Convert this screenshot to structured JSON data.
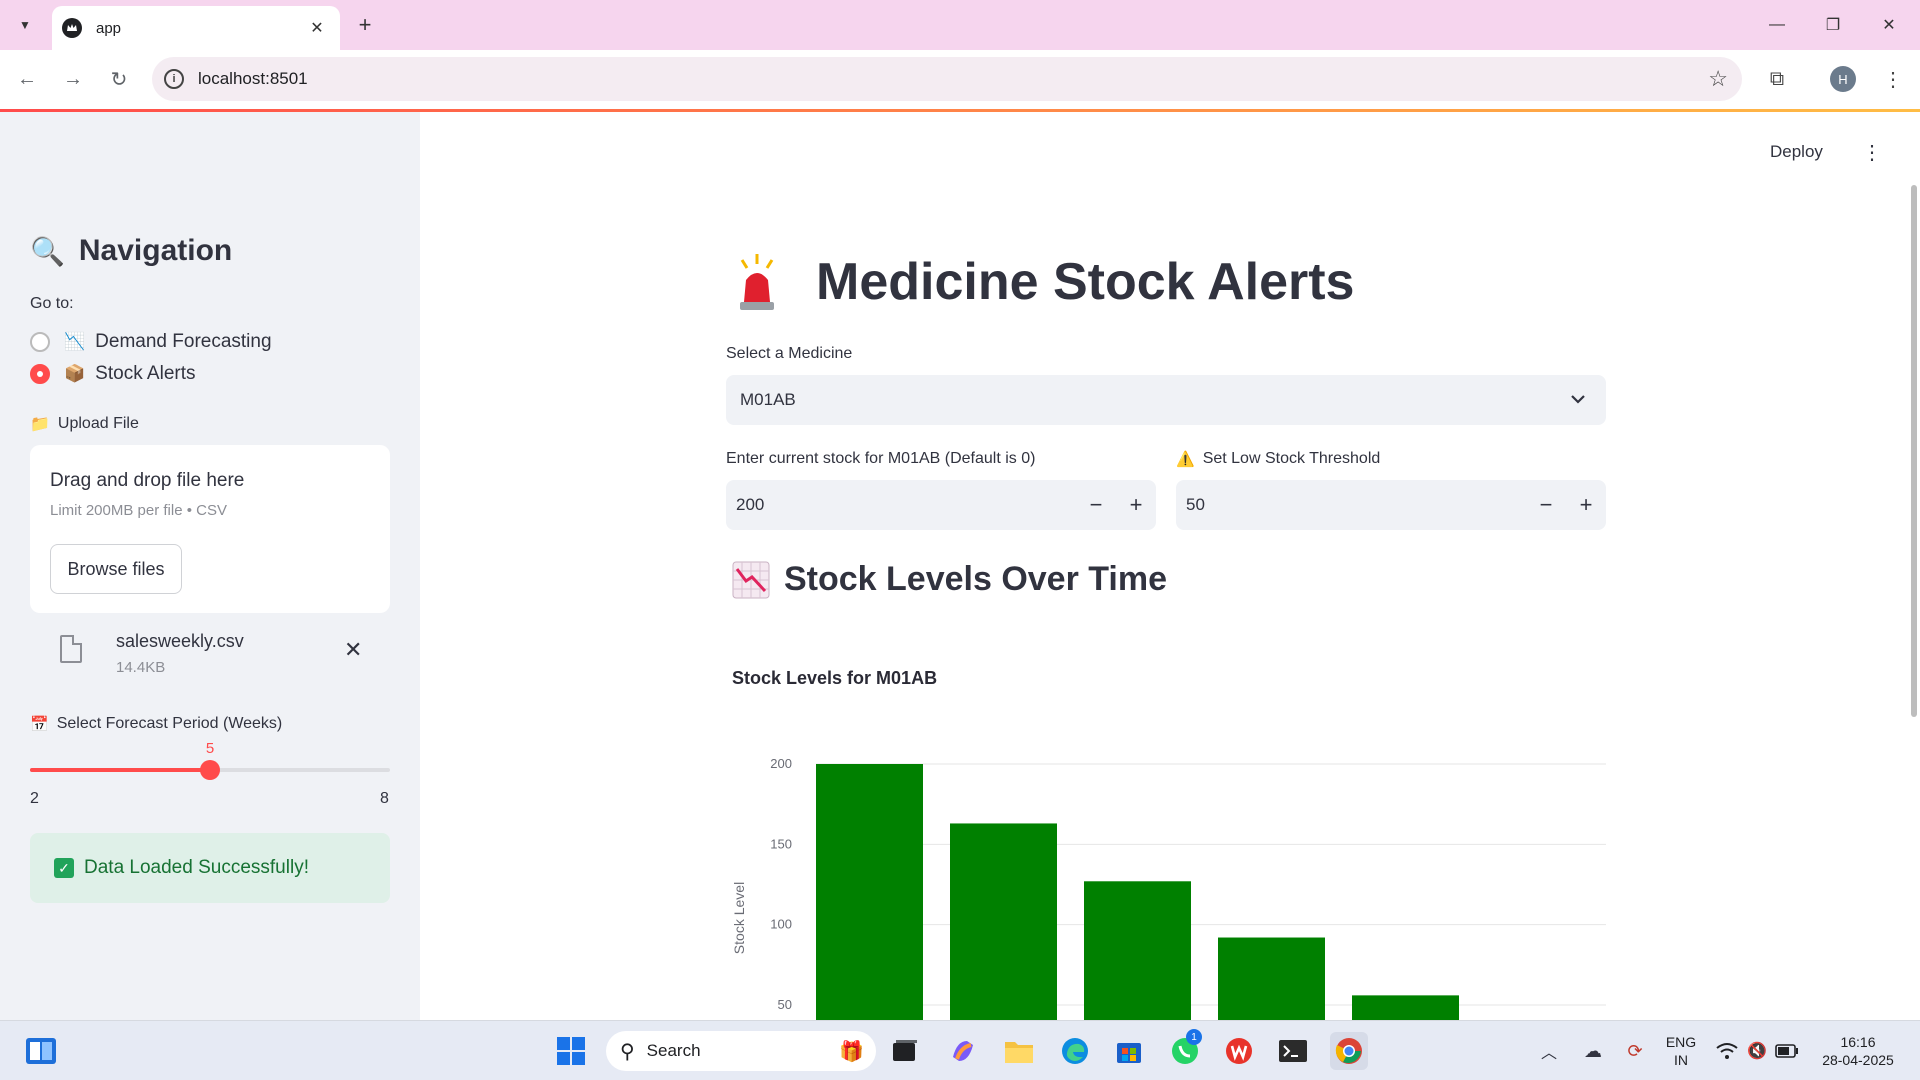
{
  "browser": {
    "tab_title": "app",
    "url": "localhost:8501",
    "profile_initial": "H"
  },
  "sidebar": {
    "nav_title": "Navigation",
    "goto_label": "Go to:",
    "radio_options": [
      {
        "emoji": "📉",
        "label": "Demand Forecasting",
        "selected": false
      },
      {
        "emoji": "📦",
        "label": "Stock Alerts",
        "selected": true
      }
    ],
    "upload_label": "Upload File",
    "dropzone_title": "Drag and drop file here",
    "dropzone_sub": "Limit 200MB per file • CSV",
    "browse_label": "Browse files",
    "file": {
      "name": "salesweekly.csv",
      "size": "14.4KB"
    },
    "forecast_label": "Select Forecast Period (Weeks)",
    "slider": {
      "value": "5",
      "min": "2",
      "max": "8",
      "fraction": 0.5
    },
    "success_text": "Data Loaded Successfully!"
  },
  "header": {
    "deploy_label": "Deploy"
  },
  "main": {
    "title": "Medicine Stock Alerts",
    "select_label": "Select a Medicine",
    "select_value": "M01AB",
    "stock_label": "Enter current stock for M01AB (Default is 0)",
    "stock_value": "200",
    "threshold_label": "Set Low Stock Threshold",
    "threshold_value": "50",
    "section_title": "Stock Levels Over Time"
  },
  "chart_data": {
    "type": "bar",
    "title": "Stock Levels for M01AB",
    "ylabel": "Stock Level",
    "xlabel": "",
    "values": [
      200,
      163,
      127,
      92,
      56
    ],
    "yticks": [
      50,
      100,
      150,
      200
    ],
    "ylim_visible": [
      40,
      200
    ],
    "bar_color": "#008000",
    "grid": true
  },
  "taskbar": {
    "search_label": "Search",
    "lang_line1": "ENG",
    "lang_line2": "IN",
    "time": "16:16",
    "date": "28-04-2025",
    "whatsapp_badge": "1"
  },
  "colors": {
    "accent": "#ff4b4b",
    "success_bg": "#dff0e8",
    "success_text": "#177233"
  }
}
